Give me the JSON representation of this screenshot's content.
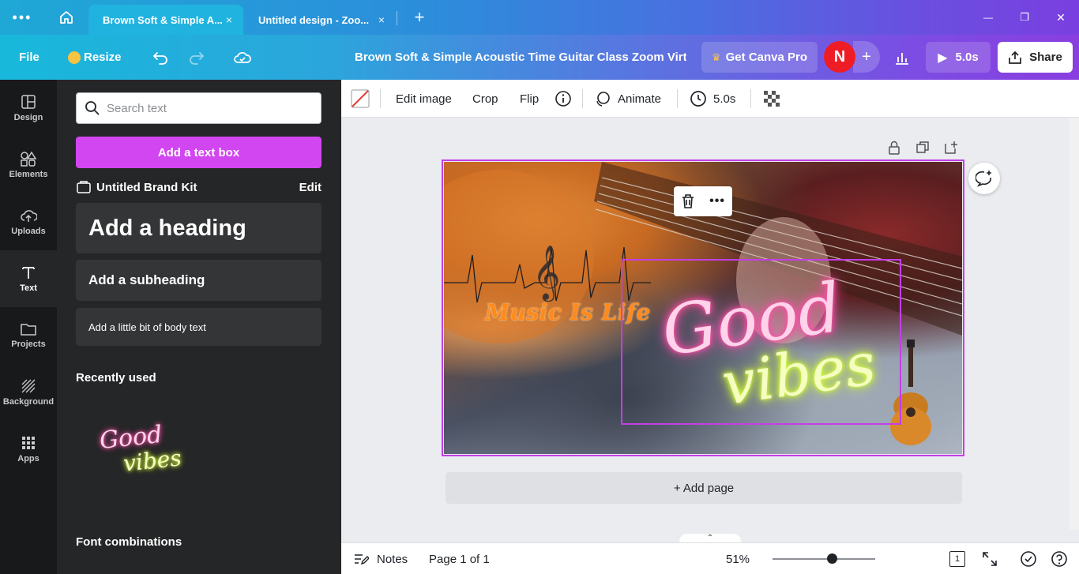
{
  "tabs": [
    {
      "label": "Brown Soft & Simple A...",
      "close": "×"
    },
    {
      "label": "Untitled design - Zoo...",
      "close": "×"
    }
  ],
  "new_tab": "+",
  "window_controls": {
    "minimize": "—",
    "restore": "❐",
    "close": "✕"
  },
  "toolbar": {
    "file": "File",
    "resize": "Resize",
    "doc_title": "Brown Soft & Simple Acoustic Time Guitar Class Zoom Virtu...",
    "get_pro": "Get Canva Pro",
    "avatar": "N",
    "add_member": "+",
    "present_time": "5.0s",
    "share": "Share"
  },
  "rail": [
    {
      "label": "Design",
      "icon": "design-icon"
    },
    {
      "label": "Elements",
      "icon": "elements-icon"
    },
    {
      "label": "Uploads",
      "icon": "uploads-icon"
    },
    {
      "label": "Text",
      "icon": "text-icon",
      "active": true
    },
    {
      "label": "Projects",
      "icon": "folder-icon"
    },
    {
      "label": "Background",
      "icon": "background-icon"
    },
    {
      "label": "Apps",
      "icon": "apps-icon"
    }
  ],
  "panel": {
    "search_placeholder": "Search text",
    "add_textbox": "Add a text box",
    "brand_kit": "Untitled Brand Kit",
    "brand_edit": "Edit",
    "heading": "Add a heading",
    "subheading": "Add a subheading",
    "body": "Add a little bit of body text",
    "recently_used": "Recently used",
    "recent_item": {
      "line1": "Good",
      "line2": "vibes"
    },
    "font_combinations": "Font combinations"
  },
  "context_toolbar": {
    "edit_image": "Edit image",
    "crop": "Crop",
    "flip": "Flip",
    "animate": "Animate",
    "duration": "5.0s"
  },
  "design": {
    "music_text": "Music Is Life",
    "good": "Good",
    "vibes": "vibes",
    "colors": {
      "neon_pink": "#ff4fa8",
      "neon_yellow": "#e6ff4a",
      "orange": "#ff8a1c",
      "selection": "#c43ee6"
    }
  },
  "add_page": "+ Add page",
  "bottom": {
    "notes": "Notes",
    "page": "Page 1 of 1",
    "zoom": "51%",
    "zoom_level": 0.58,
    "page_count": "1"
  }
}
